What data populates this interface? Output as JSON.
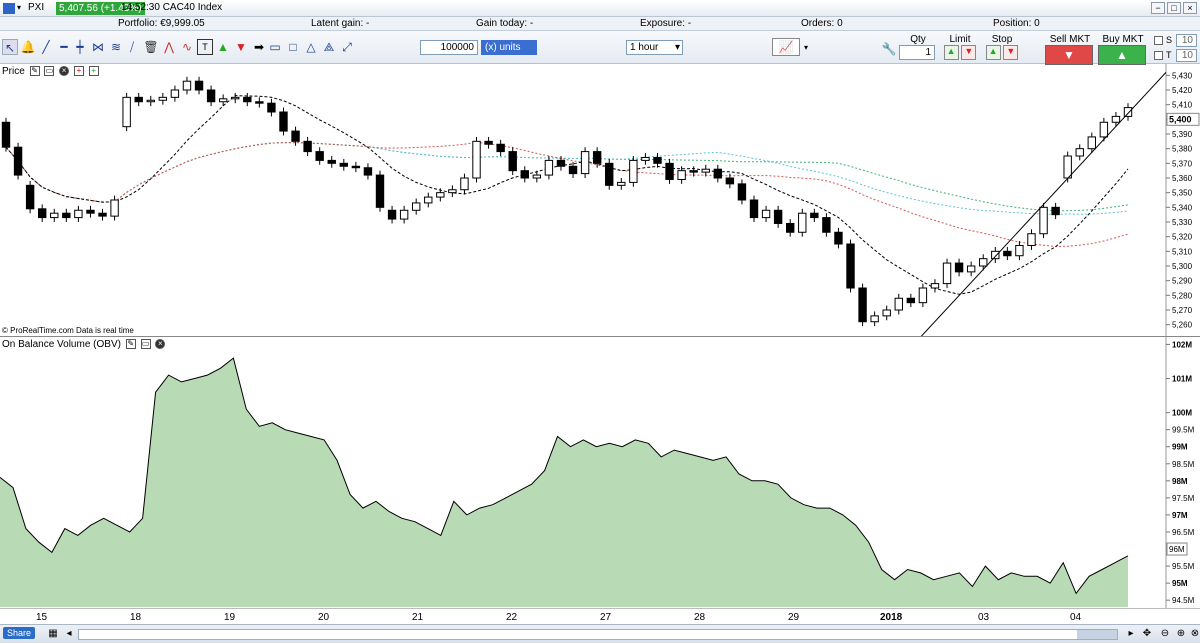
{
  "titlebar": {
    "symbol": "PXI",
    "price": "5,407.56 (+1.43%)",
    "time_name": "14:52:30 CAC40 Index",
    "minimize": "−",
    "restore": "□",
    "close": "×"
  },
  "info": {
    "portfolio": "Portfolio: €9,999.05",
    "latent": "Latent gain: -",
    "today": "Gain today: -",
    "exposure": "Exposure: -",
    "orders": "Orders: 0",
    "position": "Position: 0"
  },
  "toolbar": {
    "quantity": "100000",
    "units": "(x) units",
    "timeframe": "1 hour",
    "qty_label": "Qty",
    "qty_value": "1",
    "limit_label": "Limit",
    "stop_label": "Stop",
    "sell_label": "Sell MKT",
    "buy_label": "Buy MKT",
    "s_label": "S",
    "s_value": "10",
    "t_label": "T",
    "t_value": "10"
  },
  "price_pane": {
    "title": "Price",
    "credit": "© ProRealTime.com Data is real time",
    "yticks": [
      "5,430",
      "5,420",
      "5,410",
      "5,400",
      "5,390",
      "5,380",
      "5,370",
      "5,360",
      "5,350",
      "5,340",
      "5,330",
      "5,320",
      "5,310",
      "5,300",
      "5,290",
      "5,280",
      "5,270",
      "5,260"
    ],
    "current": "5,400"
  },
  "obv_pane": {
    "title": "On Balance Volume (OBV)",
    "yticks": [
      "102M",
      "101M",
      "100M",
      "99.5M",
      "99M",
      "98.5M",
      "98M",
      "97.5M",
      "97M",
      "96.5M",
      "96M",
      "95.5M",
      "95M",
      "94.5M"
    ],
    "current": "96M"
  },
  "xaxis": {
    "labels": [
      "15",
      "18",
      "19",
      "20",
      "21",
      "22",
      "27",
      "28",
      "29",
      "2018",
      "03",
      "04"
    ]
  },
  "bottom": {
    "share": "Share"
  },
  "icons": [
    "cursor-icon",
    "bell-icon",
    "line-icon",
    "hline-icon",
    "vline-icon",
    "channel-icon",
    "fibonacci-icon",
    "trash-icon",
    "text-icon",
    "buy-arrow-icon",
    "sell-arrow-icon",
    "rect-icon",
    "triangle-icon",
    "zoom-icon"
  ],
  "chart_data": {
    "type": "line",
    "title": "",
    "price_series": [
      {
        "o": 5398,
        "c": 5381
      },
      {
        "o": 5381,
        "c": 5362
      },
      {
        "o": 5355,
        "c": 5339
      },
      {
        "o": 5339,
        "c": 5333
      },
      {
        "o": 5333,
        "c": 5336
      },
      {
        "o": 5336,
        "c": 5333
      },
      {
        "o": 5333,
        "c": 5338
      },
      {
        "o": 5338,
        "c": 5336
      },
      {
        "o": 5336,
        "c": 5334
      },
      {
        "o": 5334,
        "c": 5345
      },
      {
        "o": 5395,
        "c": 5415
      },
      {
        "o": 5415,
        "c": 5412
      },
      {
        "o": 5412,
        "c": 5413
      },
      {
        "o": 5413,
        "c": 5415
      },
      {
        "o": 5415,
        "c": 5420
      },
      {
        "o": 5420,
        "c": 5426
      },
      {
        "o": 5426,
        "c": 5420
      },
      {
        "o": 5420,
        "c": 5412
      },
      {
        "o": 5412,
        "c": 5414
      },
      {
        "o": 5414,
        "c": 5415
      },
      {
        "o": 5415,
        "c": 5412
      },
      {
        "o": 5412,
        "c": 5411
      },
      {
        "o": 5411,
        "c": 5405
      },
      {
        "o": 5405,
        "c": 5392
      },
      {
        "o": 5392,
        "c": 5385
      },
      {
        "o": 5385,
        "c": 5378
      },
      {
        "o": 5378,
        "c": 5372
      },
      {
        "o": 5372,
        "c": 5370
      },
      {
        "o": 5370,
        "c": 5368
      },
      {
        "o": 5368,
        "c": 5367
      },
      {
        "o": 5367,
        "c": 5362
      },
      {
        "o": 5362,
        "c": 5340
      },
      {
        "o": 5338,
        "c": 5332
      },
      {
        "o": 5332,
        "c": 5338
      },
      {
        "o": 5338,
        "c": 5343
      },
      {
        "o": 5343,
        "c": 5347
      },
      {
        "o": 5347,
        "c": 5350
      },
      {
        "o": 5350,
        "c": 5352
      },
      {
        "o": 5352,
        "c": 5360
      },
      {
        "o": 5360,
        "c": 5385
      },
      {
        "o": 5385,
        "c": 5383
      },
      {
        "o": 5383,
        "c": 5378
      },
      {
        "o": 5378,
        "c": 5365
      },
      {
        "o": 5365,
        "c": 5360
      },
      {
        "o": 5360,
        "c": 5362
      },
      {
        "o": 5362,
        "c": 5372
      },
      {
        "o": 5372,
        "c": 5368
      },
      {
        "o": 5368,
        "c": 5363
      },
      {
        "o": 5363,
        "c": 5378
      },
      {
        "o": 5378,
        "c": 5370
      },
      {
        "o": 5370,
        "c": 5355
      },
      {
        "o": 5355,
        "c": 5357
      },
      {
        "o": 5357,
        "c": 5372
      },
      {
        "o": 5372,
        "c": 5374
      },
      {
        "o": 5374,
        "c": 5370
      },
      {
        "o": 5370,
        "c": 5359
      },
      {
        "o": 5359,
        "c": 5365
      },
      {
        "o": 5365,
        "c": 5364
      },
      {
        "o": 5364,
        "c": 5366
      },
      {
        "o": 5366,
        "c": 5360
      },
      {
        "o": 5360,
        "c": 5356
      },
      {
        "o": 5356,
        "c": 5345
      },
      {
        "o": 5345,
        "c": 5333
      },
      {
        "o": 5333,
        "c": 5338
      },
      {
        "o": 5338,
        "c": 5329
      },
      {
        "o": 5329,
        "c": 5323
      },
      {
        "o": 5323,
        "c": 5336
      },
      {
        "o": 5336,
        "c": 5333
      },
      {
        "o": 5333,
        "c": 5323
      },
      {
        "o": 5323,
        "c": 5315
      },
      {
        "o": 5315,
        "c": 5285
      },
      {
        "o": 5285,
        "c": 5262
      },
      {
        "o": 5262,
        "c": 5266
      },
      {
        "o": 5266,
        "c": 5270
      },
      {
        "o": 5270,
        "c": 5278
      },
      {
        "o": 5278,
        "c": 5275
      },
      {
        "o": 5275,
        "c": 5285
      },
      {
        "o": 5285,
        "c": 5288
      },
      {
        "o": 5288,
        "c": 5302
      },
      {
        "o": 5302,
        "c": 5296
      },
      {
        "o": 5296,
        "c": 5300
      },
      {
        "o": 5300,
        "c": 5305
      },
      {
        "o": 5305,
        "c": 5310
      },
      {
        "o": 5310,
        "c": 5307
      },
      {
        "o": 5307,
        "c": 5314
      },
      {
        "o": 5314,
        "c": 5322
      },
      {
        "o": 5322,
        "c": 5340
      },
      {
        "o": 5340,
        "c": 5335
      },
      {
        "o": 5360,
        "c": 5375
      },
      {
        "o": 5375,
        "c": 5380
      },
      {
        "o": 5380,
        "c": 5388
      },
      {
        "o": 5388,
        "c": 5398
      },
      {
        "o": 5398,
        "c": 5402
      },
      {
        "o": 5402,
        "c": 5408
      }
    ],
    "obv_values": [
      98.1,
      97.8,
      96.6,
      96.2,
      95.9,
      96.6,
      96.4,
      96.7,
      96.9,
      96.7,
      96.5,
      96.9,
      100.6,
      101.1,
      100.9,
      101.0,
      101.1,
      101.3,
      101.6,
      100.1,
      99.6,
      99.7,
      99.5,
      99.4,
      99.3,
      99.2,
      98.6,
      97.6,
      97.2,
      97.4,
      97.1,
      96.9,
      96.8,
      96.6,
      96.4,
      97.4,
      97.0,
      97.2,
      97.3,
      97.5,
      97.7,
      97.9,
      98.3,
      99.3,
      99.0,
      99.2,
      99.0,
      99.1,
      99.0,
      99.2,
      99.1,
      98.7,
      98.9,
      98.8,
      98.7,
      98.6,
      98.7,
      98.2,
      98.0,
      98.0,
      97.9,
      97.5,
      97.3,
      97.2,
      97.2,
      97.0,
      96.7,
      96.2,
      95.4,
      95.1,
      95.4,
      95.3,
      95.1,
      95.2,
      95.3,
      94.9,
      95.5,
      95.1,
      95.3,
      95.2,
      95.2,
      95.0,
      95.6,
      94.7,
      95.2,
      95.4,
      95.6,
      95.8
    ],
    "colors": {
      "up": "#ffffff",
      "down": "#000000",
      "obv_fill": "#b8dab4",
      "sma_black": "#000000",
      "sma_red": "#d9534f",
      "sma_green": "#3cb371",
      "sma_cyan": "#5bc0de"
    }
  }
}
